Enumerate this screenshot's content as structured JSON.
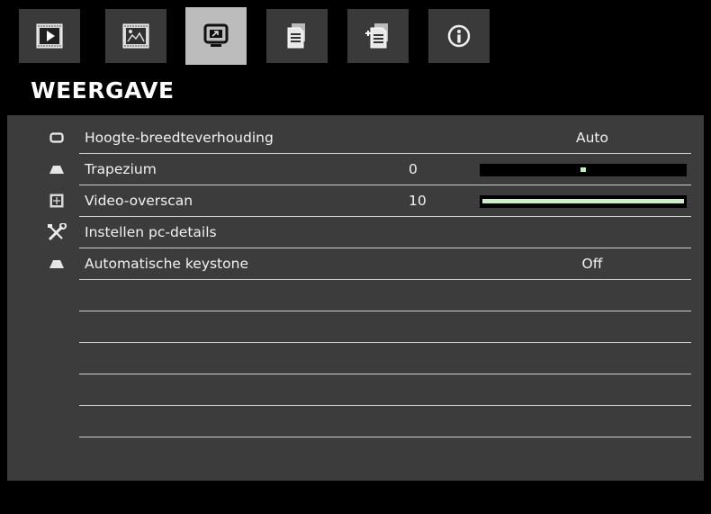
{
  "tabs": [
    {
      "icon": "image-settings-icon",
      "active": false
    },
    {
      "icon": "advanced-image-icon",
      "active": false
    },
    {
      "icon": "display-icon",
      "active": true
    },
    {
      "icon": "settings-document-icon",
      "active": false
    },
    {
      "icon": "advanced-settings-icon",
      "active": false
    },
    {
      "icon": "info-icon",
      "active": false
    }
  ],
  "title": "WEERGAVE",
  "menu": {
    "rows": [
      {
        "icon": "aspect-ratio-icon",
        "label": "Hoogte-breedteverhouding",
        "num": "",
        "value": "Auto",
        "slider": null
      },
      {
        "icon": "keystone-icon",
        "label": "Trapezium",
        "num": "0",
        "value": "",
        "slider": {
          "fraction": 0.5,
          "mode": "center"
        }
      },
      {
        "icon": "overscan-icon",
        "label": "Video-overscan",
        "num": "10",
        "value": "",
        "slider": {
          "fraction": 1.0,
          "mode": "fill"
        }
      },
      {
        "icon": "tools-icon",
        "label": "Instellen pc-details",
        "num": "",
        "value": "",
        "slider": null
      },
      {
        "icon": "keystone-icon",
        "label": "Automatische keystone",
        "num": "",
        "value": "Off",
        "slider": null
      },
      {
        "icon": "",
        "label": "",
        "num": "",
        "value": "",
        "slider": null
      },
      {
        "icon": "",
        "label": "",
        "num": "",
        "value": "",
        "slider": null
      },
      {
        "icon": "",
        "label": "",
        "num": "",
        "value": "",
        "slider": null
      },
      {
        "icon": "",
        "label": "",
        "num": "",
        "value": "",
        "slider": null
      },
      {
        "icon": "",
        "label": "",
        "num": "",
        "value": "",
        "slider": null
      }
    ]
  },
  "colors": {
    "panel": "#3c3c3c",
    "active_tab": "#bcbcbc",
    "slider_fill": "#c8f0c0"
  }
}
